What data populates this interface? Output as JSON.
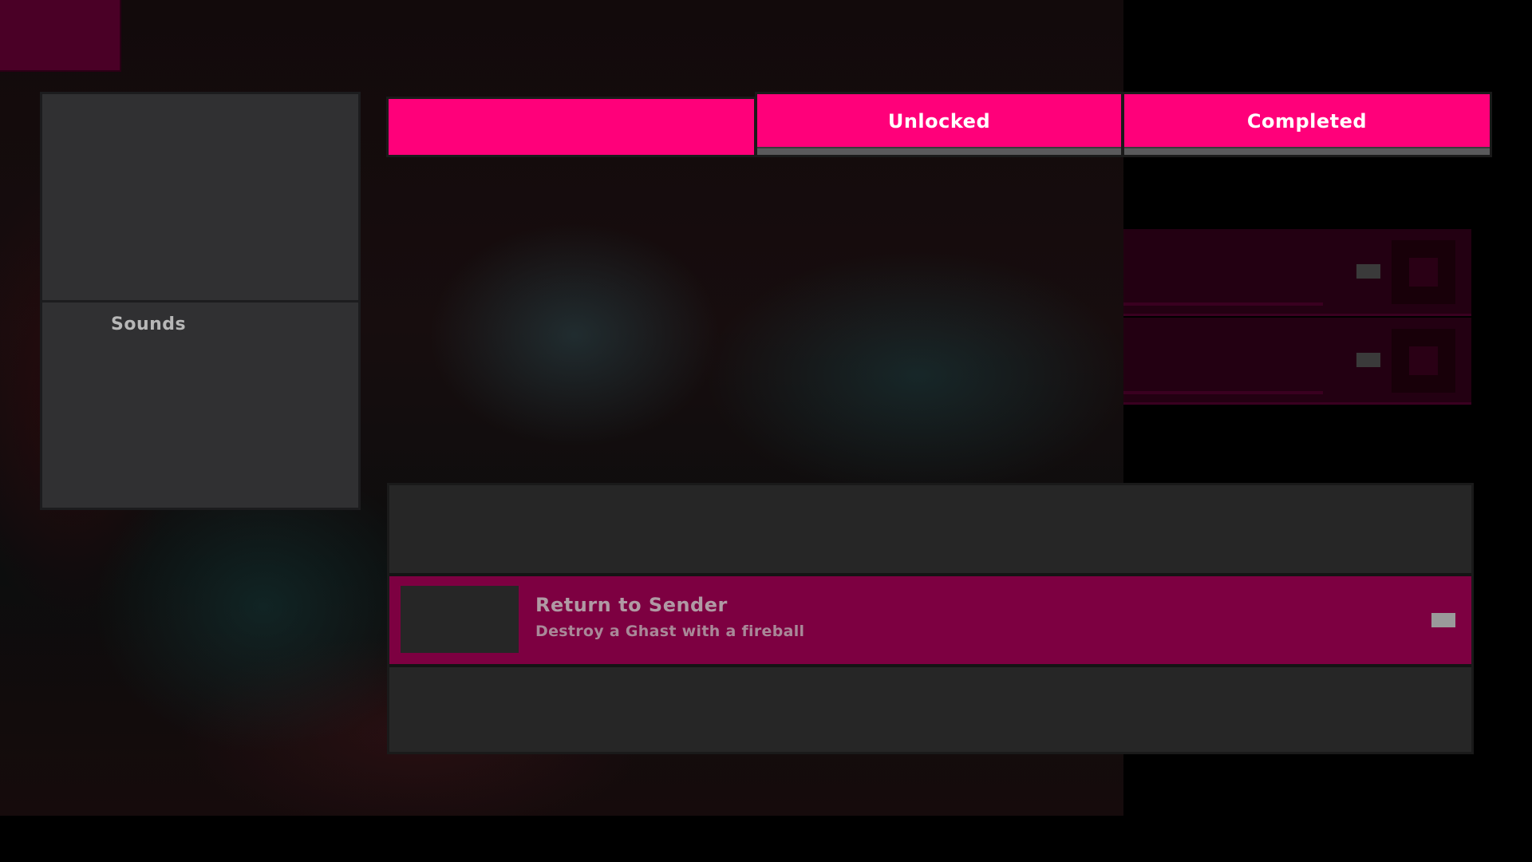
{
  "background": {
    "description_color": "#170d0e"
  },
  "accent_color": "#ff007a",
  "left_panel": {
    "label": "Sounds"
  },
  "tabs": [
    {
      "label": ""
    },
    {
      "label": "Unlocked"
    },
    {
      "label": "Completed"
    }
  ],
  "list": {
    "items": [
      {
        "title": "Return to Sender",
        "subtitle": "Destroy a Ghast with a fireball"
      }
    ]
  }
}
